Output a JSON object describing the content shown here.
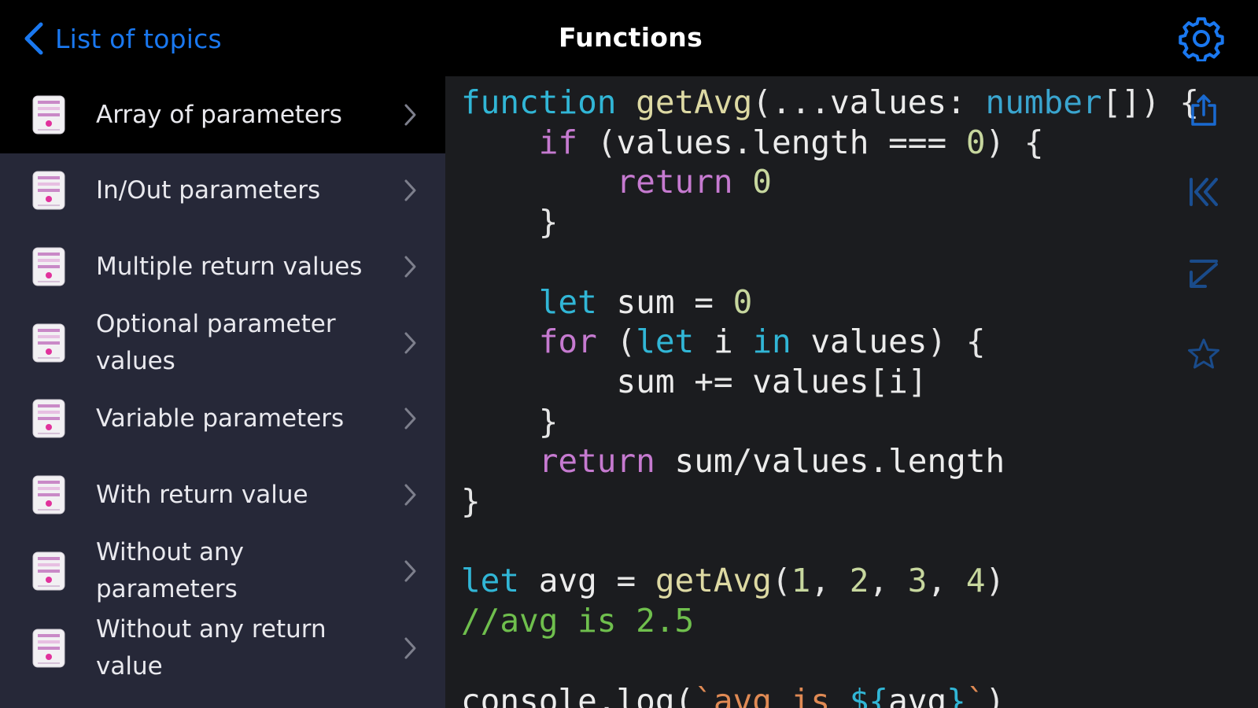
{
  "header": {
    "back_label": "List of topics",
    "title": "Functions",
    "back_icon": "chevron-left-icon",
    "settings_icon": "gear-icon"
  },
  "sidebar": {
    "items": [
      {
        "label": "Array of parameters",
        "selected": true
      },
      {
        "label": "In/Out parameters",
        "selected": false
      },
      {
        "label": "Multiple return values",
        "selected": false
      },
      {
        "label": "Optional parameter values",
        "selected": false
      },
      {
        "label": "Variable parameters",
        "selected": false
      },
      {
        "label": "With return value",
        "selected": false
      },
      {
        "label": "Without any parameters",
        "selected": false
      },
      {
        "label": "Without any return value",
        "selected": false
      }
    ],
    "item_icon": "code-file-icon",
    "chevron_icon": "chevron-right-icon"
  },
  "code": {
    "lines": [
      "function getAvg(...values: number[]) {",
      "    if (values.length === 0) {",
      "        return 0",
      "    }",
      "",
      "    let sum = 0",
      "    for (let i in values) {",
      "        sum += values[i]",
      "    }",
      "    return sum/values.length",
      "}",
      "",
      "let avg = getAvg(1, 2, 3, 4)",
      "//avg is 2.5",
      "",
      "console.log(`avg is ${avg}`)"
    ]
  },
  "toolbar": {
    "icons": [
      "share-icon",
      "first-icon",
      "last-icon",
      "star-icon"
    ]
  },
  "colors": {
    "accent": "#1a78f0",
    "sidebar_bg": "#262838",
    "code_bg": "#1b1c1f",
    "keyword_blue": "#31b6d6",
    "keyword_pink": "#c67ad0",
    "comment": "#6fbf4d"
  }
}
